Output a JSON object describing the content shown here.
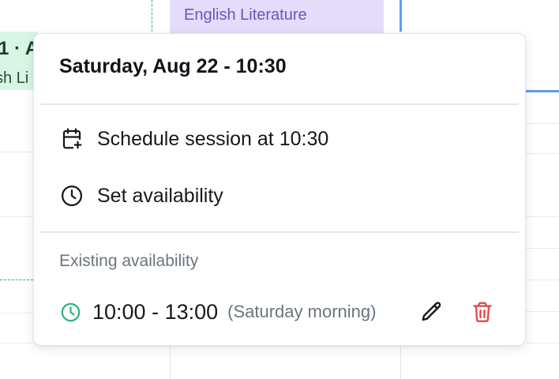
{
  "calendar": {
    "events": [
      {
        "title_fragment": "1 · A",
        "subtitle_fragment": "sh Li",
        "color": "#d7f6e4"
      },
      {
        "title": "English Literature",
        "color": "#e3dcfb"
      }
    ],
    "now_indicator_color": "#5b9ef0"
  },
  "popover": {
    "title": "Saturday, Aug 22 - 10:30",
    "actions": [
      {
        "label": "Schedule session at 10:30",
        "icon": "calendar-plus-icon"
      },
      {
        "label": "Set availability",
        "icon": "clock-icon"
      }
    ],
    "existing": {
      "section_label": "Existing availability",
      "items": [
        {
          "time": "10:00 - 13:00",
          "note": "(Saturday morning)",
          "icon": "clock-icon",
          "icon_color": "#2fb37f",
          "edit_icon": "pencil-icon",
          "delete_icon": "trash-icon",
          "delete_color": "#e5484d"
        }
      ]
    }
  }
}
